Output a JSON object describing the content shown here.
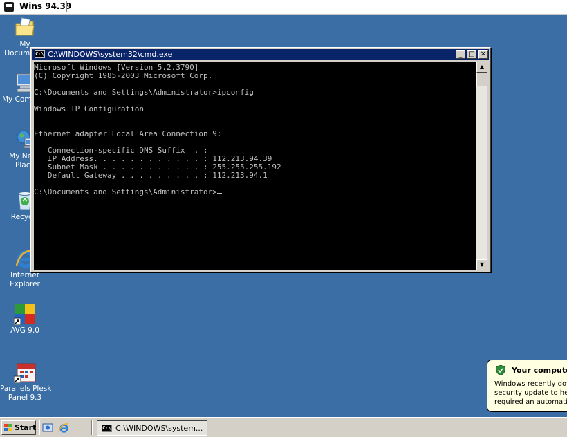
{
  "app_bar": {
    "title": "Wins 94.39"
  },
  "desktop_icons": [
    {
      "name": "my-documents",
      "label": "My Documents",
      "icon": "folder-with-document-icon"
    },
    {
      "name": "my-computer",
      "label": "My Comp",
      "icon": "computer-icon"
    },
    {
      "name": "my-network-places",
      "label": "My Netw\nPlace",
      "icon": "network-globe-icon"
    },
    {
      "name": "recycle-bin",
      "label": "Recycle",
      "icon": "recycle-bin-icon"
    },
    {
      "name": "internet-explorer",
      "label": "Internet\nExplorer",
      "icon": "internet-explorer-icon"
    },
    {
      "name": "avg",
      "label": "AVG 9.0",
      "icon": "avg-antivirus-icon"
    },
    {
      "name": "parallels-plesk",
      "label": "Parallels Plesk\nPanel 9.3",
      "icon": "plesk-calendar-icon"
    }
  ],
  "cmd_window": {
    "title": "C:\\WINDOWS\\system32\\cmd.exe",
    "icon_text": "C:\\",
    "controls": {
      "minimize": "_",
      "maximize": "□",
      "close": "✕"
    },
    "lines": [
      "Microsoft Windows [Version 5.2.3790]",
      "(C) Copyright 1985-2003 Microsoft Corp.",
      "",
      "C:\\Documents and Settings\\Administrator>ipconfig",
      "",
      "Windows IP Configuration",
      "",
      "",
      "Ethernet adapter Local Area Connection 9:",
      "",
      "   Connection-specific DNS Suffix  . :",
      "   IP Address. . . . . . . . . . . . : 112.213.94.39",
      "   Subnet Mask . . . . . . . . . . . : 255.255.255.192",
      "   Default Gateway . . . . . . . . . : 112.213.94.1",
      "",
      "C:\\Documents and Settings\\Administrator>"
    ],
    "scroll_up": "▲",
    "scroll_down": "▼"
  },
  "taskbar": {
    "start_label": "Start",
    "task_item_label": "C:\\WINDOWS\\system...",
    "task_item_icon_text": "C:\\"
  },
  "notification": {
    "title": "Your computer",
    "body": "Windows recently dow\nsecurity update to hel\nrequired an automatic"
  },
  "colors": {
    "desktop": "#3a6ea5",
    "titlebar_active": "#0a246a",
    "console_bg": "#000000",
    "console_text": "#c0c0c0",
    "balloon_bg": "#ffffe1"
  }
}
